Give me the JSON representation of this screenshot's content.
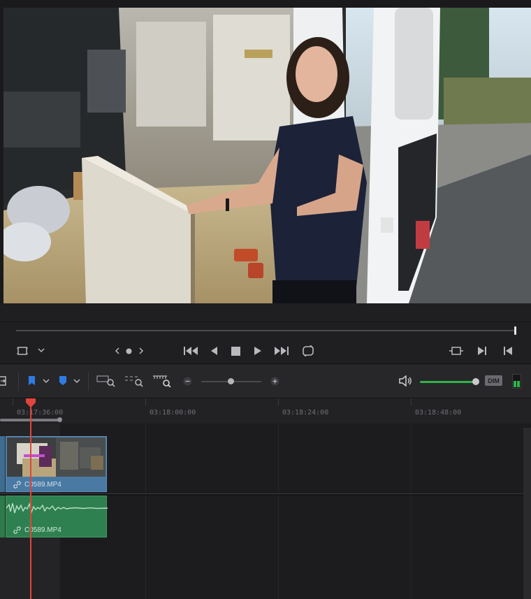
{
  "timeline": {
    "ruler_labels": [
      "03:17:36:00",
      "03:18:00:00",
      "03:18:24:00",
      "03:18:48:00"
    ],
    "video_clip": {
      "name": "C0589.MP4",
      "color": "#4a7aa3"
    },
    "audio_clip": {
      "name": "C0589.MP4",
      "color": "#2f8050"
    },
    "playhead_color": "#e0453b"
  },
  "toolbar": {
    "dim_label": "DIM",
    "volume_level": 0.95,
    "zoom_level": 0.45,
    "accent_color": "#2fb34a",
    "flag_color": "#2f7be0"
  },
  "transport": {
    "scrub_position": 1.0
  },
  "icons": [
    "viewer-frame-icon",
    "chevron-down-icon",
    "prev-frame-icon",
    "dot-icon",
    "next-frame-icon",
    "skip-to-start-icon",
    "play-reverse-icon",
    "stop-icon",
    "play-icon",
    "skip-to-end-icon",
    "loop-icon",
    "match-frame-icon",
    "mark-in-icon",
    "mark-out-icon",
    "flag-icon",
    "marker-icon",
    "zoom-full-icon",
    "zoom-detail-icon",
    "zoom-custom-icon",
    "zoom-out-icon",
    "zoom-in-icon",
    "speaker-icon",
    "link-icon"
  ]
}
